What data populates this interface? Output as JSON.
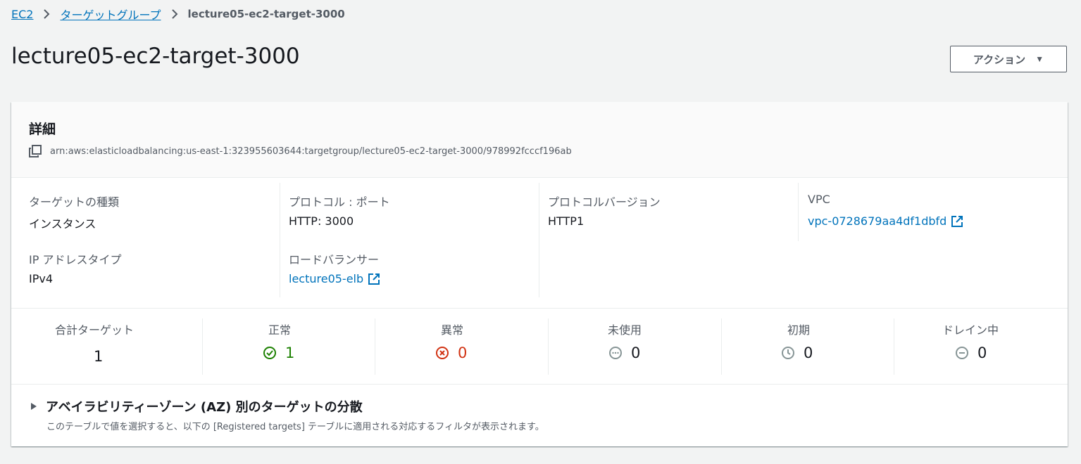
{
  "breadcrumb": {
    "root": "EC2",
    "target_groups": "ターゲットグループ",
    "current": "lecture05-ec2-target-3000"
  },
  "page": {
    "title": "lecture05-ec2-target-3000",
    "actions_label": "アクション"
  },
  "details": {
    "title": "詳細",
    "arn": "arn:aws:elasticloadbalancing:us-east-1:323955603644:targetgroup/lecture05-ec2-target-3000/978992fcccf196ab",
    "target_type_label": "ターゲットの種類",
    "target_type_value": "インスタンス",
    "ip_type_label": "IP アドレスタイプ",
    "ip_type_value": "IPv4",
    "protocol_port_label": "プロトコル : ポート",
    "protocol_port_value": "HTTP: 3000",
    "load_balancer_label": "ロードバランサー",
    "load_balancer_value": "lecture05-elb",
    "protocol_version_label": "プロトコルバージョン",
    "protocol_version_value": "HTTP1",
    "vpc_label": "VPC",
    "vpc_value": "vpc-0728679aa4df1dbfd"
  },
  "stats": {
    "total_label": "合計ターゲット",
    "total_value": "1",
    "healthy_label": "正常",
    "healthy_value": "1",
    "unhealthy_label": "異常",
    "unhealthy_value": "0",
    "unused_label": "未使用",
    "unused_value": "0",
    "initial_label": "初期",
    "initial_value": "0",
    "draining_label": "ドレイン中",
    "draining_value": "0"
  },
  "az": {
    "title": "アベイラビリティーゾーン (AZ) 別のターゲットの分散",
    "description": "このテーブルで値を選択すると、以下の [Registered targets] テーブルに適用される対応するフィルタが表示されます。"
  },
  "colors": {
    "link": "#0073bb",
    "healthy": "#1d8102",
    "unhealthy": "#d13212",
    "neutral": "#879596"
  }
}
